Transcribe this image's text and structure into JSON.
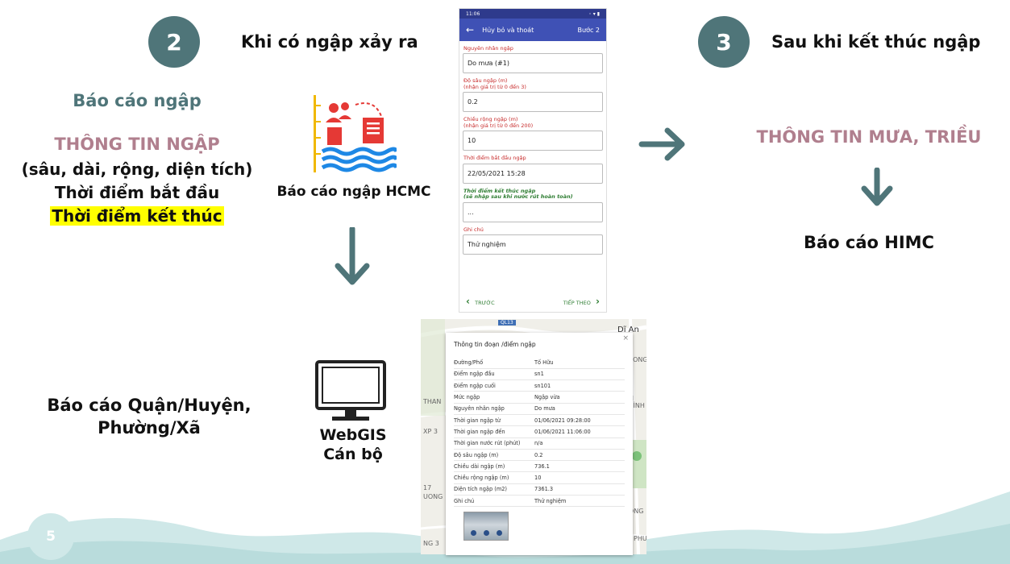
{
  "step2": {
    "number": "2",
    "title": "Khi có ngập xảy ra"
  },
  "step3": {
    "number": "3",
    "title": "Sau khi kết thúc ngập"
  },
  "left": {
    "heading": "Báo cáo ngập",
    "info_title": "THÔNG TIN NGẬP",
    "line1": "(sâu, dài, rộng, diện tích)",
    "line2": "Thời điểm bắt đầu",
    "line3": "Thời điểm kết thúc"
  },
  "app_label": "Báo cáo ngập HCMC",
  "district_report": {
    "line1": "Báo cáo Quận/Huyện,",
    "line2": "Phường/Xã"
  },
  "webgis": {
    "line1": "WebGIS",
    "line2": "Cán bộ"
  },
  "right": {
    "info_title": "THÔNG TIN MƯA, TRIỀU",
    "report": "Báo cáo HIMC"
  },
  "page_number": "5",
  "phone": {
    "status_time": "11:06",
    "status_right": "◦ ▾ ▮",
    "toolbar_back": "←",
    "toolbar_title": "Hủy bỏ và thoát",
    "toolbar_step": "Bước 2",
    "fields": [
      {
        "label": "Nguyên nhân ngập",
        "value": "Do mưa (#1)"
      },
      {
        "label": "Độ sâu ngập (m)\n(nhận giá trị từ 0 đến 3)",
        "value": "0.2"
      },
      {
        "label": "Chiều rộng ngập (m)\n(nhận giá trị từ 0 đến 200)",
        "value": "10"
      },
      {
        "label": "Thời điểm bắt đầu ngập",
        "value": "22/05/2021 15:28"
      },
      {
        "label": "Thời điểm kết thúc ngập\n(sẽ nhập sau khi nước rút hoàn toàn)",
        "value": "..."
      },
      {
        "label": "Ghi chú",
        "value": "Thử nghiệm"
      }
    ],
    "nav_prev": "TRƯỚC",
    "nav_next": "TIẾP THEO"
  },
  "map": {
    "place_top_right": "Dĩ An",
    "place_left1": "THAN",
    "place_left2": "XP 3",
    "place_left3": "17",
    "place_left4": "UONG",
    "place_bottom_left": "NG 3",
    "place_right1": "SONG",
    "place_right2": "N BÌNH",
    "place_right3": "ONG",
    "place_right4": "PHU",
    "road_badge": "QL13"
  },
  "popup": {
    "title": "Thông tin đoạn /điểm ngập",
    "close": "×",
    "rows": [
      {
        "key": "Đường/Phố",
        "value": "Tố Hữu"
      },
      {
        "key": "Điểm ngập đầu",
        "value": "sn1"
      },
      {
        "key": "Điểm ngập cuối",
        "value": "sn101"
      },
      {
        "key": "Mức ngập",
        "value": "Ngập vừa"
      },
      {
        "key": "Nguyên nhân ngập",
        "value": "Do mưa"
      },
      {
        "key": "Thời gian ngập từ",
        "value": "01/06/2021 09:28:00"
      },
      {
        "key": "Thời gian ngập đến",
        "value": "01/06/2021 11:06:00"
      },
      {
        "key": "Thời gian nước rút (phút)",
        "value": "n/a"
      },
      {
        "key": "Độ sâu ngập (m)",
        "value": "0.2"
      },
      {
        "key": "Chiều dài ngập (m)",
        "value": "736.1"
      },
      {
        "key": "Chiều rộng ngập (m)",
        "value": "10"
      },
      {
        "key": "Diện tích ngập (m2)",
        "value": "7361.3"
      },
      {
        "key": "Ghi chú",
        "value": "Thử nghiệm"
      }
    ]
  },
  "colors": {
    "teal": "#4f7579",
    "mauve": "#b07f8e",
    "highlight": "#ffff00",
    "phone_bar": "#3f51b5",
    "wave": "#b9dcdc"
  }
}
